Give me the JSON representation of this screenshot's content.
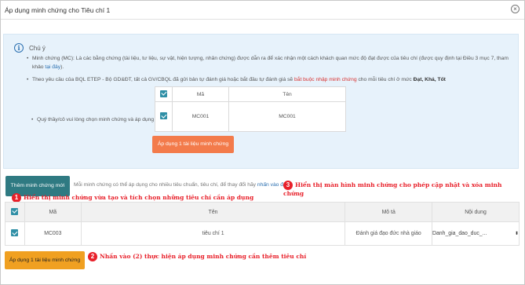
{
  "modal": {
    "title": "Áp dụng minh chứng cho Tiêu chí 1"
  },
  "note": {
    "title": "Chú ý",
    "bullet1_a": "Minh chứng (MC): Là các bằng chứng (tài liệu, tư liệu, sự vật, hiện tượng, nhân chứng) được dẫn ra để xác nhận một cách khách quan mức độ đạt được của tiêu chí (được quy định tại Điều 3 mục 7, tham khảo",
    "bullet1_link": "tại đây",
    "bullet1_end": ").",
    "bullet2_a": "Theo yêu cầu của BQL ETEP - Bộ GD&ĐT, tất cả GV/CBQL đã gửi bản tự đánh giá hoặc bắt đầu tự đánh giá sẽ",
    "bullet2_red": "bắt buộc nhập minh chứng",
    "bullet2_b": "cho mỗi tiêu chí ở mức",
    "bullet2_bold": "Đạt, Khá, Tốt",
    "choose_label": "Quý thầy/cô vui lòng chọn minh chứng và áp dụng",
    "mini_table": {
      "headers": {
        "code": "Mã",
        "name": "Tên"
      },
      "row": {
        "code": "MC001",
        "name": "MC001"
      }
    },
    "apply_button": "Áp dụng 1 tài liệu minh chứng"
  },
  "toolbar": {
    "new_button": "Thêm minh chứng mới",
    "helper_a": "Mỗi minh chứng có thể áp dụng cho nhiều tiêu chuẩn, tiêu chí, để thay đổi hãy",
    "helper_link": "nhấn vào đây"
  },
  "annotations": {
    "a1_num": "1",
    "a1_text": "Hiển thị minh chứng vừa tạo và tích chọn những tiêu chí cần áp dụng",
    "a2_num": "2",
    "a2_text": "Nhấn vào (2) thực hiện áp dụng minh chứng cần thêm tiêu chí",
    "a3_num": "3",
    "a3_text": "Hiển thị màn hình minh chứng cho phép cập nhật và xóa minh chứng"
  },
  "table": {
    "headers": {
      "code": "Mã",
      "name": "Tên",
      "description": "Mô tả",
      "content": "Nội dung"
    },
    "rows": [
      {
        "code": "MC003",
        "name": "tiêu chí 1",
        "description": "Đánh giá đạo đức nhà giáo",
        "content": "Danh_gia_dao_duc_..."
      }
    ]
  },
  "bottom": {
    "apply_button": "Áp dụng 1 tài liệu minh chứng"
  },
  "colors": {
    "accent_orange": "#f37b4b",
    "teal": "#2f7a82",
    "annotation_red": "#e8202a"
  }
}
